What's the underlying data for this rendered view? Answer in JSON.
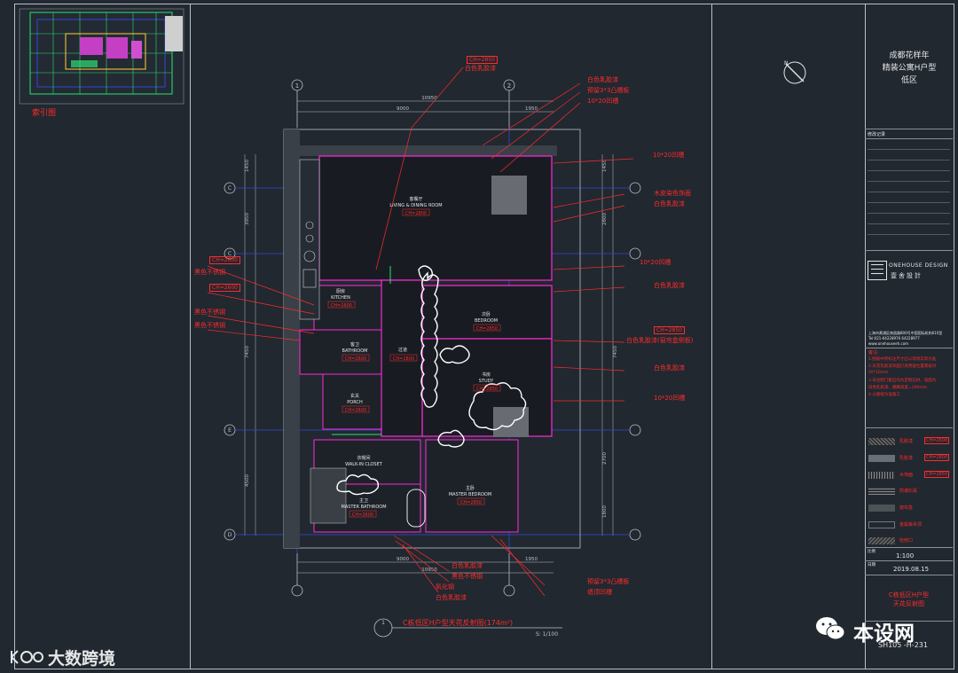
{
  "keyplan": {
    "label": "索引图"
  },
  "plan": {
    "grid_top": [
      "1",
      "2"
    ],
    "grid_left": [
      "C",
      "C",
      "E",
      "E",
      "D"
    ],
    "dims_top": [
      "10950",
      "9000",
      "1950"
    ],
    "dims_left": [
      "1450",
      "3950",
      "7450",
      "4500"
    ],
    "dims_right": [
      "1450",
      "2800",
      "7450",
      "2700",
      "1800"
    ],
    "dims_bottom": [
      "9000",
      "1950",
      "10950"
    ],
    "rooms": [
      {
        "cn": "客餐厅",
        "en": "LIVING & DINING ROOM",
        "ch": "CH=2800"
      },
      {
        "cn": "厨房",
        "en": "KITCHEN",
        "ch": "CH=2600"
      },
      {
        "cn": "客卫",
        "en": "BATHROOM",
        "ch": "CH=2600"
      },
      {
        "cn": "过道",
        "en": "",
        "ch": "CH=2800"
      },
      {
        "cn": "玄关",
        "en": "PORCH",
        "ch": "CH=2600"
      },
      {
        "cn": "次卧",
        "en": "BEDROOM",
        "ch": "CH=2850"
      },
      {
        "cn": "书房",
        "en": "STUDY",
        "ch": "CH=2850"
      },
      {
        "cn": "衣帽间",
        "en": "WALK-IN CLOSET",
        "ch": ""
      },
      {
        "cn": "主卫",
        "en": "MASTER BATHROOM",
        "ch": "CH=2600"
      },
      {
        "cn": "主卧",
        "en": "MASTER BEDROOM",
        "ch": "CH=2850"
      }
    ],
    "notes_top": [
      "CH=2850",
      "白色乳胶漆",
      "白色乳胶漆",
      "预留3*3凸槽板",
      "10*20凹槽"
    ],
    "notes_right": [
      "10*20凹槽",
      "木皮染色饰面",
      "白色乳胶漆",
      "10*20凹槽",
      "白色乳胶漆",
      "CH=2850",
      "白色乳胶漆(窗帘盒侧板)",
      "白色乳胶漆",
      "10*20凹槽"
    ],
    "notes_left": [
      "CH=2600",
      "黑色不锈钢",
      "CH=2600",
      "黑色不锈钢",
      "黑色不锈钢"
    ],
    "notes_bottom": [
      "白色乳胶漆",
      "黑色不锈钢",
      "氧化钢",
      "白色乳胶漆",
      "预留3*3凸槽板",
      "墙顶凹槽"
    ],
    "caption": "C栋低区H户型天花反射图(174m²)",
    "scale": "S: 1/100",
    "caption_num": "1"
  },
  "titleblock": {
    "project_lines": [
      "成都花样年",
      "精装公寓H户型",
      "低区"
    ],
    "revision_header": "修改记录",
    "company_en": "ONEHOUSE DESIGN",
    "company_cn": "壹舍設計",
    "address": "上海市黄浦区南昌路800号中国国际机构610室",
    "tel": "Tel:021-64228976 64228977",
    "web": "www.onehouseeh.com",
    "notes_title": "备注:",
    "notes": [
      "1.图纸中所标注尺寸应以现场实际为准",
      "2.天花乳胶漆饰面灯具预留位置需核对",
      "20*10mm",
      "3.未注明门槛石均为定制石材，墙面为",
      "白色乳胶漆，踢脚高度=100mm",
      "4.以图纸为准施工"
    ],
    "legend": [
      {
        "label": "乳胶漆",
        "tag": "CH=2600"
      },
      {
        "label": "乳胶漆",
        "tag": "CH=2800"
      },
      {
        "label": "木饰面",
        "tag": "CH=2850"
      },
      {
        "label": "防潮石膏",
        "tag": ""
      },
      {
        "label": "窗帘盒",
        "tag": ""
      },
      {
        "label": "金属板吊顶",
        "tag": ""
      },
      {
        "label": "检修口",
        "tag": ""
      }
    ],
    "scale_label": "比例",
    "scale": "1:100",
    "date_label": "日期",
    "date": "2019.08.15",
    "drawing_title": [
      "C栋低区H户型",
      "天花反射图"
    ],
    "drawing_no": "SH105 -H-231"
  },
  "watermarks": {
    "left": "大数跨境",
    "right": "本设网"
  },
  "colors": {
    "bg": "#212830",
    "line": "#b9c0c8",
    "red": "#ff2b2b",
    "magenta": "#ff2bd6",
    "blue": "#2e4bd6",
    "green": "#2ee070"
  }
}
